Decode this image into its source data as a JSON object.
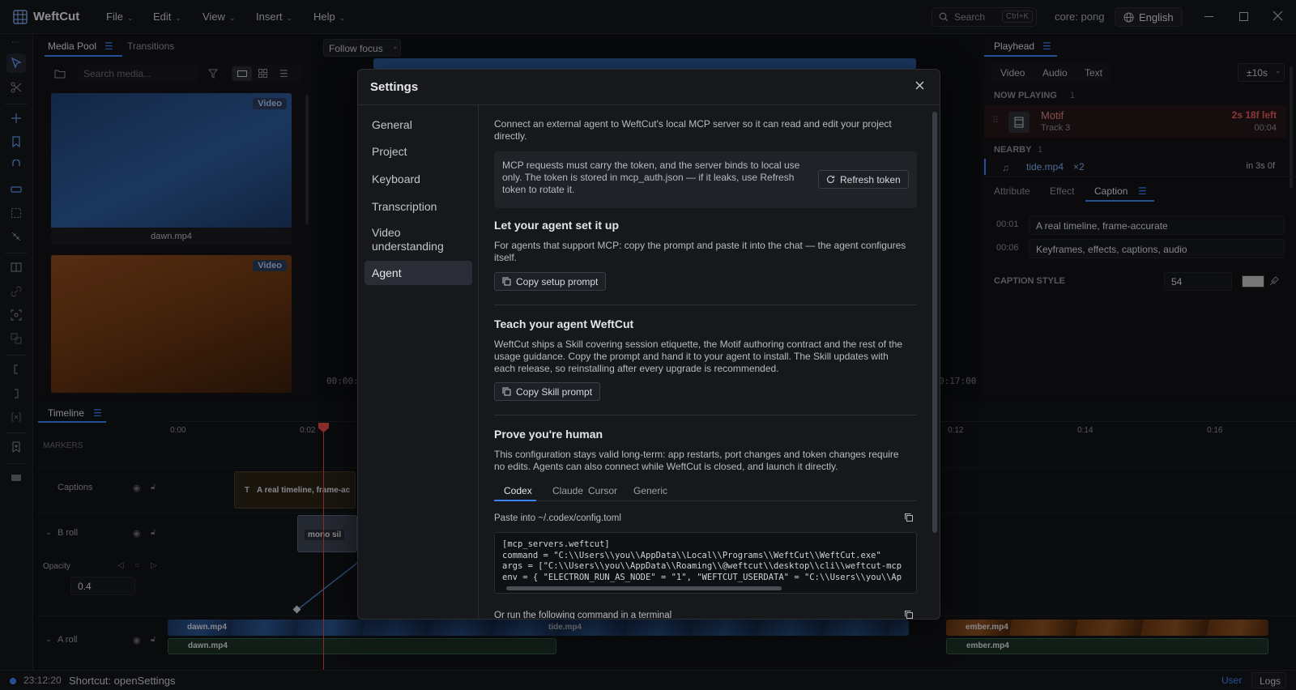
{
  "app": {
    "name": "WeftCut",
    "menus": [
      "File",
      "Edit",
      "View",
      "Insert",
      "Help"
    ],
    "search_label": "Search",
    "search_shortcut": "Ctrl+K",
    "core": "core: pong",
    "language": "English"
  },
  "media_pool": {
    "tabs": [
      "Media Pool",
      "Transitions"
    ],
    "search_placeholder": "Search media...",
    "items": [
      {
        "name": "dawn.mp4",
        "badge": "Video",
        "color": "#234a86"
      },
      {
        "name": "",
        "badge": "Video",
        "color": "#8a4a22"
      }
    ]
  },
  "viewer": {
    "follow_focus": "Follow focus",
    "time_left": "00:00:",
    "time_right": "0:17:00"
  },
  "right_panel": {
    "tab": "Playhead",
    "filters": [
      "Video",
      "Audio",
      "Text"
    ],
    "range": "±10s",
    "now_playing_label": "NOW PLAYING",
    "now_playing_count": "1",
    "motif_name": "Motif",
    "motif_track": "Track 3",
    "motif_left": "2s 18f left",
    "motif_time": "00:04",
    "nearby_label": "NEARBY",
    "nearby_count": "1",
    "nearby_file": "tide.mp4",
    "nearby_mult": "×2",
    "nearby_time": "in 3s 0f",
    "sub_tabs": [
      "Attribute",
      "Effect",
      "Caption"
    ],
    "captions": [
      {
        "time": "00:01",
        "text": "A real timeline, frame-accurate"
      },
      {
        "time": "00:06",
        "text": "Keyframes, effects, captions, audio"
      }
    ],
    "caption_style_label": "CAPTION STYLE",
    "caption_size": "54",
    "swatch_color": "#bfbfbf"
  },
  "timeline": {
    "title": "Timeline",
    "ticks": [
      "0:00",
      "0:02",
      "0:12",
      "0:14",
      "0:16"
    ],
    "markers_label": "MARKERS",
    "tracks": [
      "Captions",
      "B roll",
      "A roll"
    ],
    "opacity_label": "Opacity",
    "opacity_value": "0.4",
    "caption_clip": "A real timeline, frame-ac",
    "broll_clip": "mono sil",
    "clips": [
      "dawn.mp4",
      "tide.mp4",
      "ember.mp4"
    ],
    "audio_clips": [
      "dawn.mp4",
      "ember.mp4"
    ]
  },
  "status": {
    "time": "23:12:20",
    "message": "Shortcut: openSettings",
    "user": "User",
    "logs": "Logs"
  },
  "settings": {
    "title": "Settings",
    "nav": [
      "General",
      "Project",
      "Keyboard",
      "Transcription",
      "Video understanding",
      "Agent"
    ],
    "intro": "Connect an external agent to WeftCut's local MCP server so it can read and edit your project directly.",
    "token_note": "MCP requests must carry the token, and the server binds to local use only. The token is stored in mcp_auth.json — if it leaks, use Refresh token to rotate it.",
    "refresh_label": "Refresh token",
    "setup_head": "Let your agent set it up",
    "setup_text": "For agents that support MCP: copy the prompt and paste it into the chat — the agent configures itself.",
    "setup_btn": "Copy setup prompt",
    "teach_head": "Teach your agent WeftCut",
    "teach_text": "WeftCut ships a Skill covering session etiquette, the Motif authoring contract and the rest of the usage guidance. Copy the prompt and hand it to your agent to install. The Skill updates with each release, so reinstalling after every upgrade is recommended.",
    "teach_btn": "Copy Skill prompt",
    "human_head": "Prove you're human",
    "human_text": "This configuration stays valid long-term: app restarts, port changes and token changes require no edits. Agents can also connect while WeftCut is closed, and launch it directly.",
    "client_tabs": [
      "Codex",
      "Claude",
      "Cursor",
      "Generic"
    ],
    "paste_label": "Paste into ~/.codex/config.toml",
    "code_lines": [
      "[mcp_servers.weftcut]",
      "command = \"C:\\\\Users\\\\you\\\\AppData\\\\Local\\\\Programs\\\\WeftCut\\\\WeftCut.exe\"",
      "args = [\"C:\\\\Users\\\\you\\\\AppData\\\\Roaming\\\\@weftcut\\\\desktop\\\\cli\\\\weftcut-mcp",
      "env = { \"ELECTRON_RUN_AS_NODE\" = \"1\", \"WEFTCUT_USERDATA\" = \"C:\\\\Users\\\\you\\\\Ap"
    ],
    "terminal_label": "Or run the following command in a terminal"
  },
  "colors": {
    "accent": "#3b82f6",
    "playhead": "#e04848",
    "warn": "#e05a5a"
  }
}
